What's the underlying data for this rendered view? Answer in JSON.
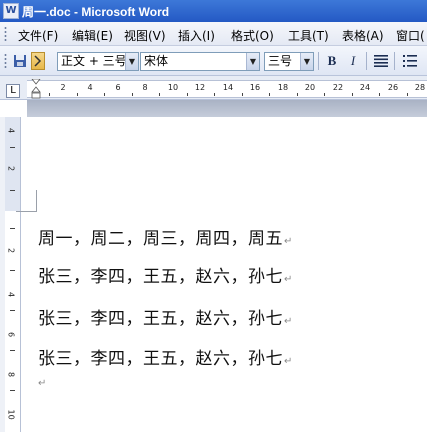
{
  "window": {
    "title": "周一.doc - Microsoft Word",
    "icon": "word-doc-icon"
  },
  "menubar": {
    "items": [
      "文件(F)",
      "编辑(E)",
      "视图(V)",
      "插入(I)",
      "格式(O)",
      "工具(T)",
      "表格(A)",
      "窗口("
    ]
  },
  "toolbar": {
    "style_value": "正文 + 三号",
    "font_value": "宋体",
    "size_value": "三号",
    "bold_label": "B",
    "italic_label": "I"
  },
  "ruler": {
    "tab_selector": "L",
    "h_numbers": [
      "2",
      "4",
      "6",
      "8",
      "10",
      "12",
      "14",
      "16",
      "18",
      "20",
      "22",
      "24",
      "26",
      "28"
    ],
    "v_numbers": [
      "4",
      "2",
      "2",
      "4",
      "6",
      "8",
      "10"
    ]
  },
  "document": {
    "lines": [
      "周一，周二，周三，周四，周五",
      "张三，李四，王五，赵六，孙七",
      "张三，李四，王五，赵六，孙七",
      "张三，李四，王五，赵六，孙七"
    ],
    "paragraph_mark": "↵"
  }
}
